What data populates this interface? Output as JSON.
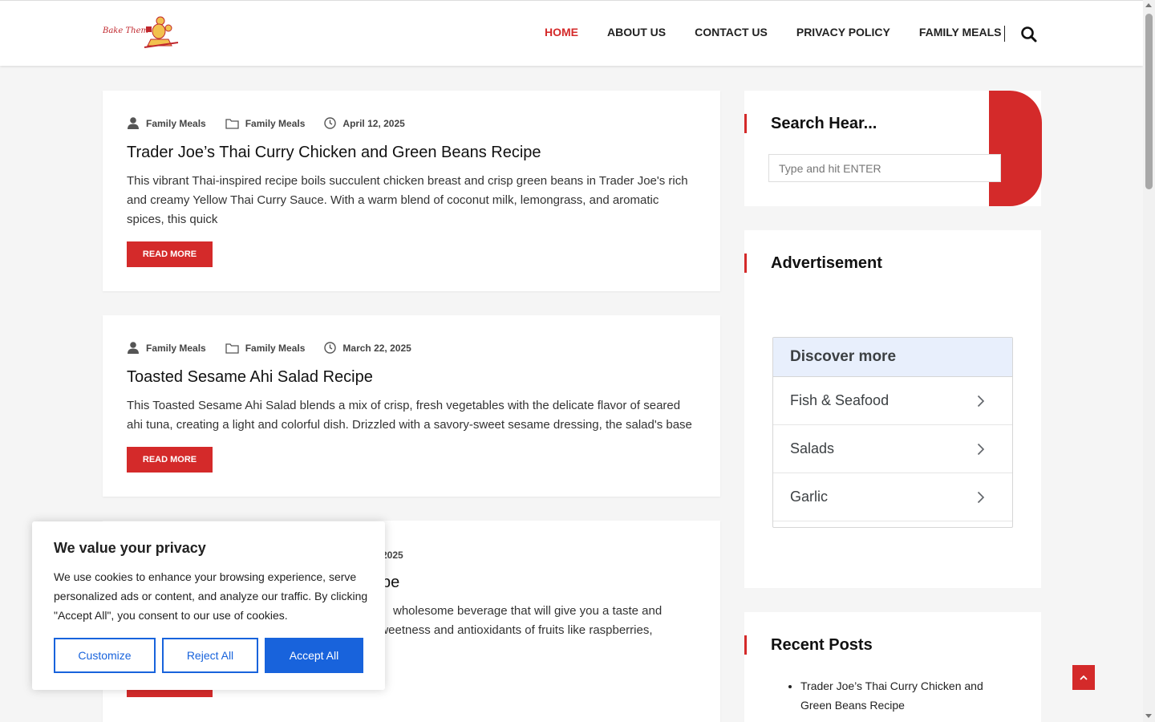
{
  "site": {
    "logo_text": "Bake Them"
  },
  "nav": {
    "items": [
      {
        "label": "HOME"
      },
      {
        "label": "ABOUT US"
      },
      {
        "label": "CONTACT US"
      },
      {
        "label": "PRIVACY POLICY"
      },
      {
        "label": "FAMILY MEALS"
      }
    ]
  },
  "posts": [
    {
      "author": "Family Meals",
      "category": "Family Meals",
      "date": "April 12, 2025",
      "title": "Trader Joe’s Thai Curry Chicken and Green Beans Recipe",
      "excerpt": "This vibrant Thai-inspired recipe boils succulent chicken breast and crisp green beans in Trader Joe's rich and creamy Yellow Thai Curry Sauce. With a warm blend of coconut milk, lemongrass, and aromatic spices, this quick",
      "button": "READ MORE"
    },
    {
      "author": "Family Meals",
      "category": "Family Meals",
      "date": "March 22, 2025",
      "title": "Toasted Sesame Ahi Salad Recipe",
      "excerpt": "This Toasted Sesame Ahi Salad blends a mix of crisp, fresh vegetables with the delicate flavor of seared ahi tuna, creating a light and colorful dish. Drizzled with a savory-sweet sesame dressing, the salad's base",
      "button": "READ MORE"
    },
    {
      "date_partial": "2025",
      "title_partial": "pe",
      "excerpt_line1": "wholesome beverage that will give you a taste and",
      "excerpt_line2": "al sweetness and antioxidants of fruits like raspberries,"
    }
  ],
  "sidebar": {
    "search_title": "Search Hear...",
    "search_placeholder": "Type and hit ENTER",
    "ad_title": "Advertisement",
    "discover_title": "Discover more",
    "discover_items": [
      {
        "label": "Fish & Seafood"
      },
      {
        "label": "Salads"
      },
      {
        "label": "Garlic"
      }
    ],
    "recent_title": "Recent Posts",
    "recent_items": [
      {
        "label": "Trader Joe’s Thai Curry Chicken and Green Beans Recipe"
      }
    ]
  },
  "cookie": {
    "title": "We value your privacy",
    "text": "We use cookies to enhance your browsing experience, serve personalized ads or content, and analyze our traffic. By clicking \"Accept All\", you consent to our use of cookies.",
    "customize": "Customize",
    "reject": "Reject All",
    "accept": "Accept All"
  },
  "colors": {
    "accent": "#d42a2a",
    "cookie_blue": "#1863dc",
    "discover_header": "#e8effc"
  }
}
